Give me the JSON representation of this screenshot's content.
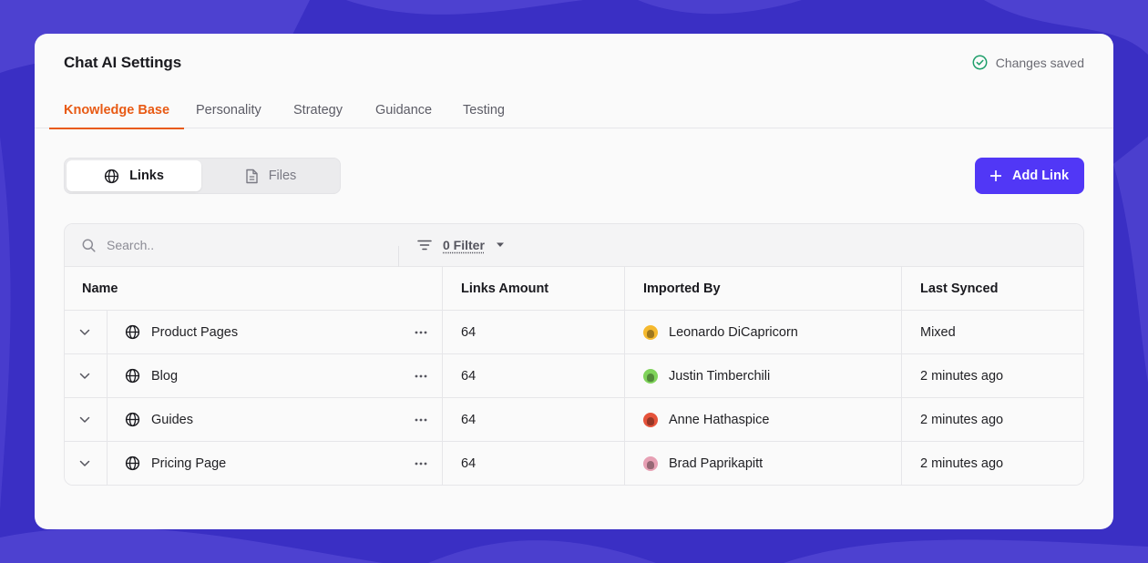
{
  "app": {
    "title": "Chat AI Settings",
    "status_text": "Changes saved",
    "status_icon": "check-circle-icon"
  },
  "tabs": [
    {
      "label": "Knowledge Base",
      "active": true
    },
    {
      "label": "Personality",
      "active": false
    },
    {
      "label": "Strategy",
      "active": false
    },
    {
      "label": "Guidance",
      "active": false
    },
    {
      "label": "Testing",
      "active": false
    }
  ],
  "segments": [
    {
      "label": "Links",
      "icon": "globe-icon",
      "active": true
    },
    {
      "label": "Files",
      "icon": "file-icon",
      "active": false
    }
  ],
  "add_button": {
    "label": "Add Link",
    "icon": "plus-icon"
  },
  "toolbar": {
    "search_placeholder": "Search..",
    "filter_label": "0 Filter",
    "filter_icon": "filter-icon"
  },
  "table": {
    "columns": [
      "Name",
      "Links Amount",
      "Imported By",
      "Last Synced"
    ],
    "rows": [
      {
        "name": "Product Pages",
        "links": "64",
        "imported_by": "Leonardo DiCapricorn",
        "avatar_color": "#f5b92e",
        "last_synced": "Mixed"
      },
      {
        "name": "Blog",
        "links": "64",
        "imported_by": "Justin Timberchili",
        "avatar_color": "#7fd35a",
        "last_synced": "2 minutes ago"
      },
      {
        "name": "Guides",
        "links": "64",
        "imported_by": "Anne Hathaspice",
        "avatar_color": "#e5533b",
        "last_synced": "2 minutes ago"
      },
      {
        "name": "Pricing Page",
        "links": "64",
        "imported_by": "Brad Paprikapitt",
        "avatar_color": "#e7a0b4",
        "last_synced": "2 minutes ago"
      }
    ]
  },
  "colors": {
    "accent": "#5137f6",
    "active_tab": "#e85a14",
    "background": "#3a2fc4",
    "success": "#1e9e6a"
  }
}
